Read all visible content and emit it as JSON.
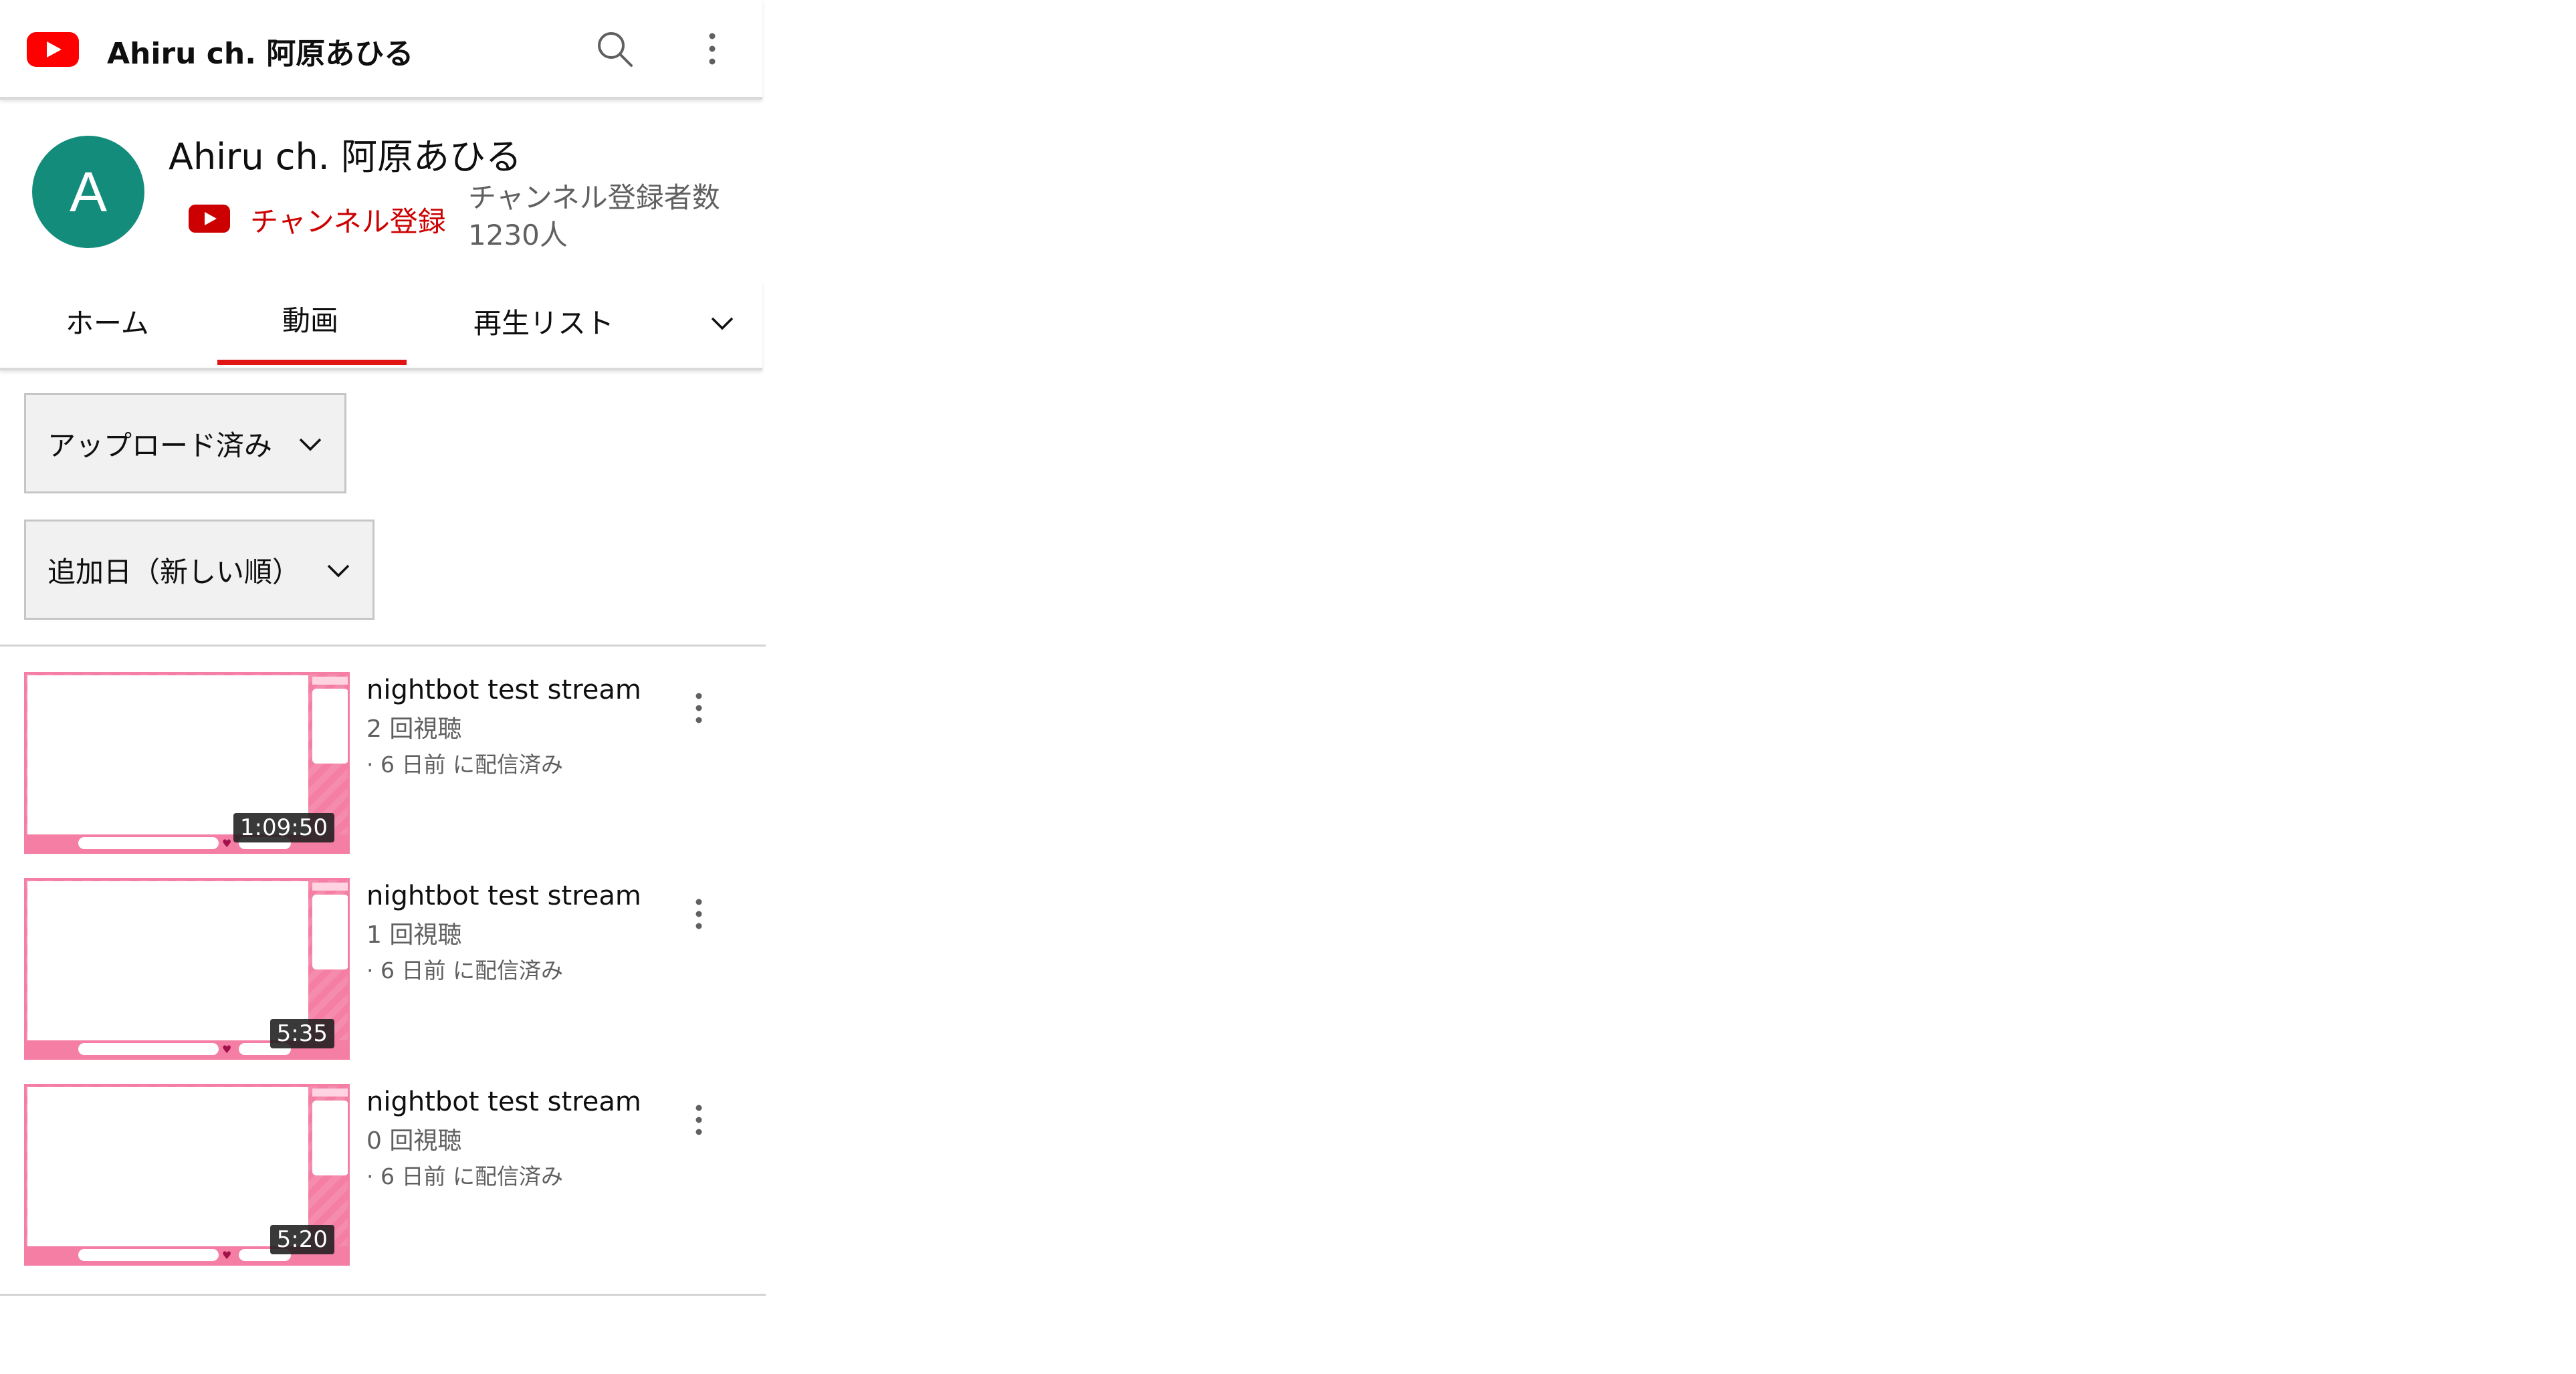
{
  "topbar": {
    "title": "Ahiru ch. 阿原あひる"
  },
  "channel": {
    "avatar_letter": "A",
    "name": "Ahiru ch. 阿原あひる",
    "subscribe_label": "チャンネル登録",
    "subscriber_count": "チャンネル登録者数 1230人"
  },
  "tabs": {
    "items": [
      "ホーム",
      "動画",
      "再生リスト"
    ],
    "active": "動画"
  },
  "filters": {
    "upload": "アップロード済み",
    "sort": "追加日（新しい順）"
  },
  "videos": [
    {
      "title": "nightbot test stream",
      "views": "2 回視聴",
      "date": "· 6 日前 に配信済み",
      "duration": "1:09:50"
    },
    {
      "title": "nightbot test stream",
      "views": "1 回視聴",
      "date": "· 6 日前 に配信済み",
      "duration": "5:35"
    },
    {
      "title": "nightbot test stream",
      "views": "0 回視聴",
      "date": "· 6 日前 に配信済み",
      "duration": "5:20"
    }
  ],
  "icons": {
    "logo": "youtube-logo-icon",
    "search": "search-icon",
    "more": "more-vert-icon",
    "chevron": "chevron-down-icon"
  },
  "colors": {
    "brand_red": "#ff0000",
    "subscribe_red": "#cc0000",
    "avatar_bg": "#138c7c",
    "tab_indicator": "#e21515",
    "thumbnail_pink": "#f47ea4"
  }
}
